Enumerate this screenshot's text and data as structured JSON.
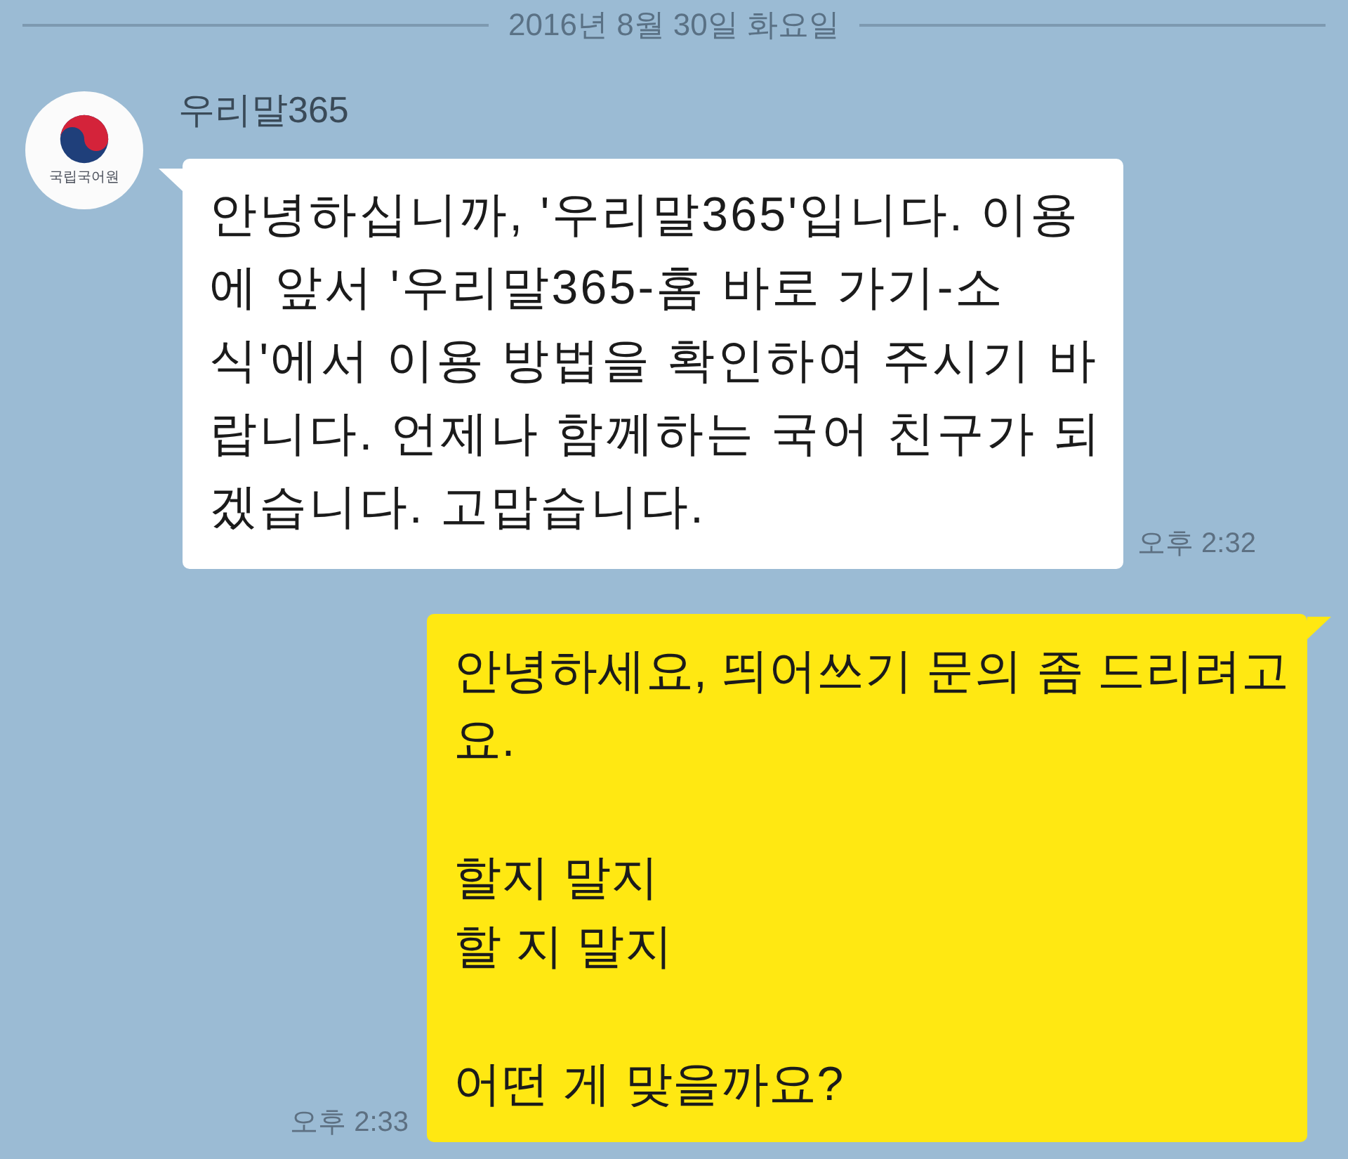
{
  "date_divider": {
    "label": "2016년 8월 30일 화요일"
  },
  "messages": [
    {
      "kind": "received",
      "sender": "우리말365",
      "avatar_caption": "국립국어원",
      "text": "안녕하십니까, '우리말365'입니다. 이용에 앞서 '우리말365-홈 바로 가기-소식'에서 이용 방법을 확인하여 주시기 바랍니다. 언제나 함께하는 국어 친구가 되겠습니다. 고맙습니다.",
      "time": "오후 2:32"
    },
    {
      "kind": "sent",
      "text": "안녕하세요, 띄어쓰기 문의 좀 드리려고요.\n\n할지 말지\n할 지 말지\n\n어떤 게 맞을까요?",
      "time": "오후 2:33"
    }
  ]
}
